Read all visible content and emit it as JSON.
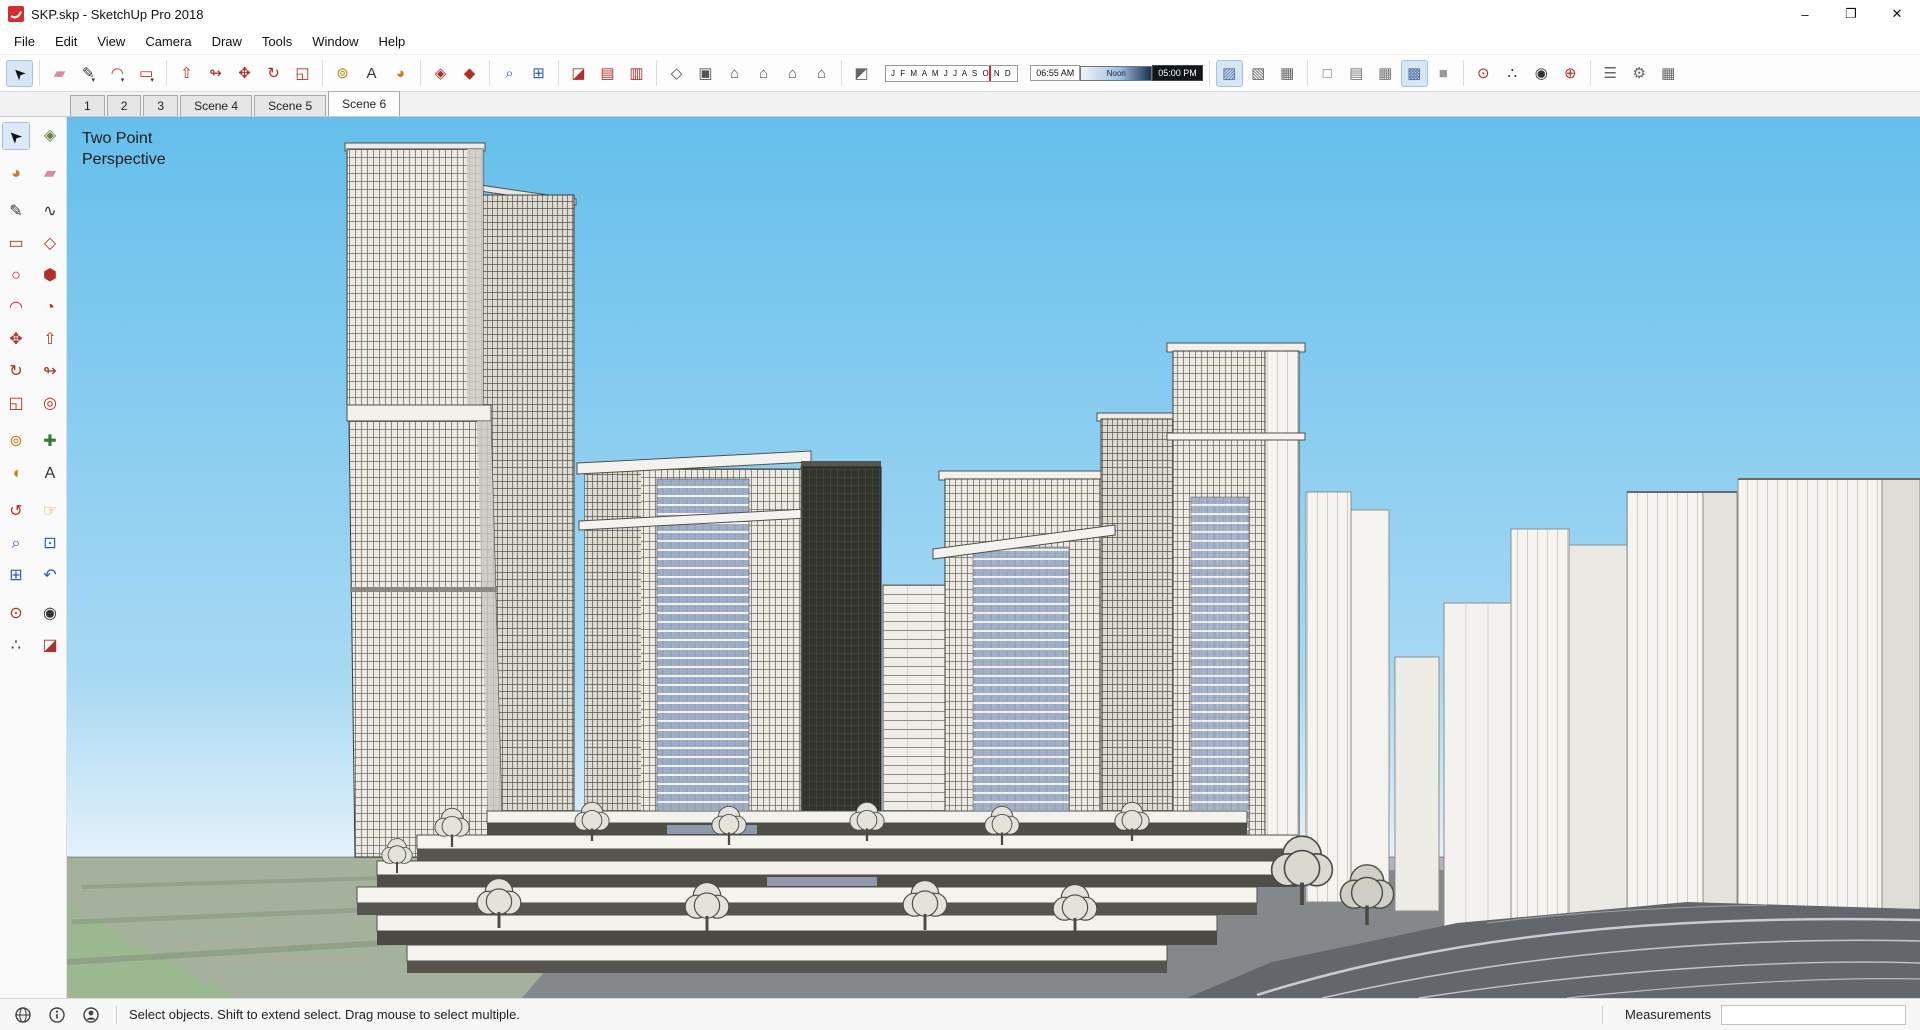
{
  "window": {
    "title": "SKP.skp - SketchUp Pro 2018",
    "controls": {
      "minimize": "–",
      "maximize": "❐",
      "close": "✕"
    }
  },
  "menu": {
    "items": [
      "File",
      "Edit",
      "View",
      "Camera",
      "Draw",
      "Tools",
      "Window",
      "Help"
    ]
  },
  "toolbar": {
    "groups": [
      {
        "name": "select",
        "items": [
          {
            "name": "select",
            "glyph": "➤",
            "color": "#111111",
            "rot": -135,
            "active": true
          }
        ]
      },
      {
        "name": "draw",
        "items": [
          {
            "name": "eraser",
            "glyph": "▰",
            "color": "#D98BA0"
          },
          {
            "name": "line",
            "glyph": "✎",
            "color": "#333333",
            "caret": true
          },
          {
            "name": "arc",
            "glyph": "◠",
            "color": "#B03028",
            "caret": true
          },
          {
            "name": "rectangle",
            "glyph": "▭",
            "color": "#B03028",
            "caret": true
          }
        ]
      },
      {
        "name": "modify",
        "items": [
          {
            "name": "push-pull",
            "glyph": "⇧",
            "color": "#B03028"
          },
          {
            "name": "follow-me",
            "glyph": "↬",
            "color": "#B03028"
          },
          {
            "name": "move",
            "glyph": "✥",
            "color": "#B03028"
          },
          {
            "name": "rotate",
            "glyph": "↻",
            "color": "#B03028"
          },
          {
            "name": "scale",
            "glyph": "◱",
            "color": "#B03028"
          }
        ]
      },
      {
        "name": "construction",
        "items": [
          {
            "name": "tape-measure",
            "glyph": "⊚",
            "color": "#B8860B"
          },
          {
            "name": "text",
            "glyph": "A",
            "color": "#333333"
          },
          {
            "name": "paint-bucket",
            "glyph": "◕",
            "color": "#C47B2E"
          }
        ]
      },
      {
        "name": "component",
        "items": [
          {
            "name": "make-component",
            "glyph": "◈",
            "color": "#B03028"
          },
          {
            "name": "make-group",
            "glyph": "◆",
            "color": "#B03028"
          }
        ]
      },
      {
        "name": "zoom",
        "items": [
          {
            "name": "zoom",
            "glyph": "⌕",
            "color": "#2A5DB0"
          },
          {
            "name": "zoom-extents",
            "glyph": "⊞",
            "color": "#2A5DB0"
          }
        ]
      },
      {
        "name": "section",
        "items": [
          {
            "name": "section-plane",
            "glyph": "◪",
            "color": "#B03028"
          },
          {
            "name": "display-section-planes",
            "glyph": "▤",
            "color": "#B03028"
          },
          {
            "name": "display-section-cuts",
            "glyph": "▥",
            "color": "#B03028"
          }
        ]
      },
      {
        "name": "views",
        "items": [
          {
            "name": "iso-view",
            "glyph": "◇",
            "color": "#555555"
          },
          {
            "name": "top-view",
            "glyph": "▣",
            "color": "#555555"
          },
          {
            "name": "front-view",
            "glyph": "⌂",
            "color": "#555555"
          },
          {
            "name": "right-view",
            "glyph": "⌂",
            "color": "#555555"
          },
          {
            "name": "back-view",
            "glyph": "⌂",
            "color": "#555555"
          },
          {
            "name": "left-view",
            "glyph": "⌂",
            "color": "#555555"
          }
        ]
      },
      {
        "name": "shadows",
        "months": "J F M A M J J A S O N D",
        "time_start": "06:55 AM",
        "time_mid": "Noon",
        "time_end": "05:00 PM",
        "items": [
          {
            "name": "shadow-toggle",
            "glyph": "◩",
            "color": "#666666"
          }
        ]
      },
      {
        "name": "edge-style",
        "items": [
          {
            "name": "x-ray",
            "glyph": "▨",
            "color": "#4A6FA5",
            "active": true
          },
          {
            "name": "back-edges",
            "glyph": "▧",
            "color": "#666666"
          },
          {
            "name": "hidden-geometry",
            "glyph": "▦",
            "color": "#666666"
          }
        ]
      },
      {
        "name": "face-style",
        "items": [
          {
            "name": "wireframe",
            "glyph": "□",
            "color": "#777777"
          },
          {
            "name": "hidden-line",
            "glyph": "▤",
            "color": "#777777"
          },
          {
            "name": "shaded",
            "glyph": "▦",
            "color": "#777777"
          },
          {
            "name": "shaded-with-textures",
            "glyph": "▩",
            "color": "#4A6FA5",
            "active": true
          },
          {
            "name": "monochrome",
            "glyph": "■",
            "color": "#999999"
          }
        ]
      },
      {
        "name": "walkthrough",
        "items": [
          {
            "name": "position-camera",
            "glyph": "⊙",
            "color": "#B03028"
          },
          {
            "name": "walk",
            "glyph": "∴",
            "color": "#333333"
          },
          {
            "name": "look-around",
            "glyph": "◉",
            "color": "#333333"
          },
          {
            "name": "add-location",
            "glyph": "⊕",
            "color": "#B03028"
          }
        ]
      },
      {
        "name": "manage",
        "items": [
          {
            "name": "model-info",
            "glyph": "☰",
            "color": "#666666"
          },
          {
            "name": "preferences",
            "glyph": "⚙",
            "color": "#666666"
          },
          {
            "name": "extension-warehouse",
            "glyph": "▦",
            "color": "#666666"
          }
        ]
      }
    ]
  },
  "scene_tabs": {
    "tabs": [
      "1",
      "2",
      "3",
      "Scene 4",
      "Scene 5",
      "Scene 6"
    ],
    "active": "Scene 6"
  },
  "palette": {
    "groups": [
      {
        "items": [
          {
            "name": "select",
            "glyph": "➤",
            "color": "#111111",
            "rot": -135,
            "active": true
          },
          {
            "name": "make-component",
            "glyph": "◈",
            "color": "#6B7F4A"
          }
        ]
      },
      {
        "items": [
          {
            "name": "paint-bucket",
            "glyph": "◕",
            "color": "#C47B2E"
          },
          {
            "name": "eraser",
            "glyph": "▰",
            "color": "#D98BA0"
          }
        ]
      },
      {
        "items": [
          {
            "name": "line",
            "glyph": "✎",
            "color": "#333333"
          },
          {
            "name": "freehand",
            "glyph": "∿",
            "color": "#333333"
          },
          {
            "name": "rectangle",
            "glyph": "▭",
            "color": "#B03028"
          },
          {
            "name": "rotated-rectangle",
            "glyph": "◇",
            "color": "#B03028"
          },
          {
            "name": "circle",
            "glyph": "○",
            "color": "#B03028"
          },
          {
            "name": "polygon",
            "glyph": "⬢",
            "color": "#B03028"
          },
          {
            "name": "arc",
            "glyph": "◠",
            "color": "#B03028"
          },
          {
            "name": "pie",
            "glyph": "◔",
            "color": "#B03028"
          },
          {
            "name": "move",
            "glyph": "✥",
            "color": "#B03028"
          },
          {
            "name": "push-pull",
            "glyph": "⇧",
            "color": "#B03028"
          },
          {
            "name": "rotate",
            "glyph": "↻",
            "color": "#B03028"
          },
          {
            "name": "follow-me",
            "glyph": "↬",
            "color": "#B03028"
          },
          {
            "name": "scale",
            "glyph": "◱",
            "color": "#B03028"
          },
          {
            "name": "offset",
            "glyph": "◎",
            "color": "#B03028"
          }
        ]
      },
      {
        "items": [
          {
            "name": "tape-measure",
            "glyph": "⊚",
            "color": "#B8860B"
          },
          {
            "name": "axes",
            "glyph": "✚",
            "color": "#2E7D32"
          },
          {
            "name": "protractor",
            "glyph": "◖",
            "color": "#B8860B"
          },
          {
            "name": "text",
            "glyph": "A",
            "color": "#333333"
          }
        ]
      },
      {
        "items": [
          {
            "name": "orbit",
            "glyph": "↺",
            "color": "#B03028"
          },
          {
            "name": "pan",
            "glyph": "☞",
            "color": "#C9A227"
          },
          {
            "name": "zoom",
            "glyph": "⌕",
            "color": "#2A5DB0"
          },
          {
            "name": "zoom-window",
            "glyph": "⊡",
            "color": "#2A5DB0"
          },
          {
            "name": "zoom-extents",
            "glyph": "⊞",
            "color": "#2A5DB0"
          },
          {
            "name": "previous-view",
            "glyph": "↶",
            "color": "#2A5DB0"
          }
        ]
      },
      {
        "items": [
          {
            "name": "position-camera",
            "glyph": "⊙",
            "color": "#B03028"
          },
          {
            "name": "look-around",
            "glyph": "◉",
            "color": "#333333"
          },
          {
            "name": "walk",
            "glyph": "∴",
            "color": "#333333"
          },
          {
            "name": "section-plane",
            "glyph": "◪",
            "color": "#B03028"
          }
        ]
      }
    ]
  },
  "viewport": {
    "overlay_line1": "Two Point",
    "overlay_line2": "Perspective"
  },
  "status_bar": {
    "hint": "Select objects. Shift to extend select. Drag mouse to select multiple.",
    "measurements_label": "Measurements",
    "measurements_value": ""
  }
}
